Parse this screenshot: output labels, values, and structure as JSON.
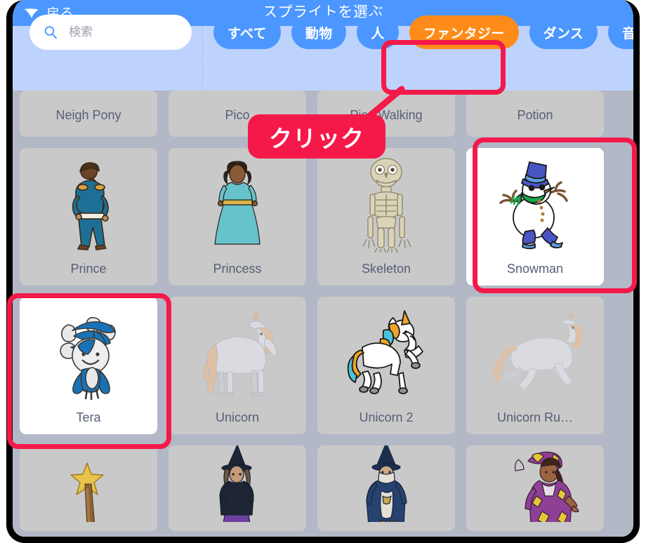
{
  "window": {
    "header": {
      "back_label": "戻る",
      "back_icon": "left-arrow-icon",
      "title": "スプライトを選ぶ"
    },
    "search": {
      "placeholder": "検索",
      "value": "",
      "icon": "search-icon"
    },
    "categories": [
      {
        "label": "すべて",
        "selected": false
      },
      {
        "label": "動物",
        "selected": false
      },
      {
        "label": "人",
        "selected": false
      },
      {
        "label": "ファンタジー",
        "selected": true
      },
      {
        "label": "ダンス",
        "selected": false
      },
      {
        "label": "音楽",
        "selected": false
      }
    ]
  },
  "annotations": {
    "callout_label": "クリック",
    "highlight_color": "#f5194a",
    "highlighted_items": [
      "ファンタジー",
      "Snowman",
      "Tera"
    ]
  },
  "colors": {
    "header_blue": "#4c97ff",
    "filterbar_blue": "#bdd3fd",
    "selected_category_orange": "#ff8c1a",
    "grid_background": "#b2b8c6",
    "card_background": "#c9c9c9",
    "card_selected_background": "#ffffff",
    "label_text": "#575e75",
    "annotation_red": "#f5194a"
  },
  "grid": {
    "rows": [
      {
        "partial": true,
        "cards": [
          {
            "label": "Neigh Pony",
            "selected": false
          },
          {
            "label": "Pico",
            "selected": false
          },
          {
            "label": "Pico Walking",
            "selected": false
          },
          {
            "label": "Potion",
            "selected": false
          }
        ]
      },
      {
        "partial": false,
        "cards": [
          {
            "label": "Prince",
            "selected": false,
            "art": "prince"
          },
          {
            "label": "Princess",
            "selected": false,
            "art": "princess"
          },
          {
            "label": "Skeleton",
            "selected": false,
            "art": "skeleton"
          },
          {
            "label": "Snowman",
            "selected": true,
            "art": "snowman"
          }
        ]
      },
      {
        "partial": false,
        "cards": [
          {
            "label": "Tera",
            "selected": true,
            "art": "tera"
          },
          {
            "label": "Unicorn",
            "selected": false,
            "art": "unicorn"
          },
          {
            "label": "Unicorn 2",
            "selected": false,
            "art": "unicorn2"
          },
          {
            "label": "Unicorn Ru…",
            "selected": false,
            "art": "unicorn-running"
          }
        ]
      },
      {
        "partial": true,
        "cards": [
          {
            "label": "",
            "selected": false,
            "art": "wand"
          },
          {
            "label": "",
            "selected": false,
            "art": "witch"
          },
          {
            "label": "",
            "selected": false,
            "art": "wizard"
          },
          {
            "label": "",
            "selected": false,
            "art": "wizard-girl"
          }
        ]
      }
    ]
  }
}
